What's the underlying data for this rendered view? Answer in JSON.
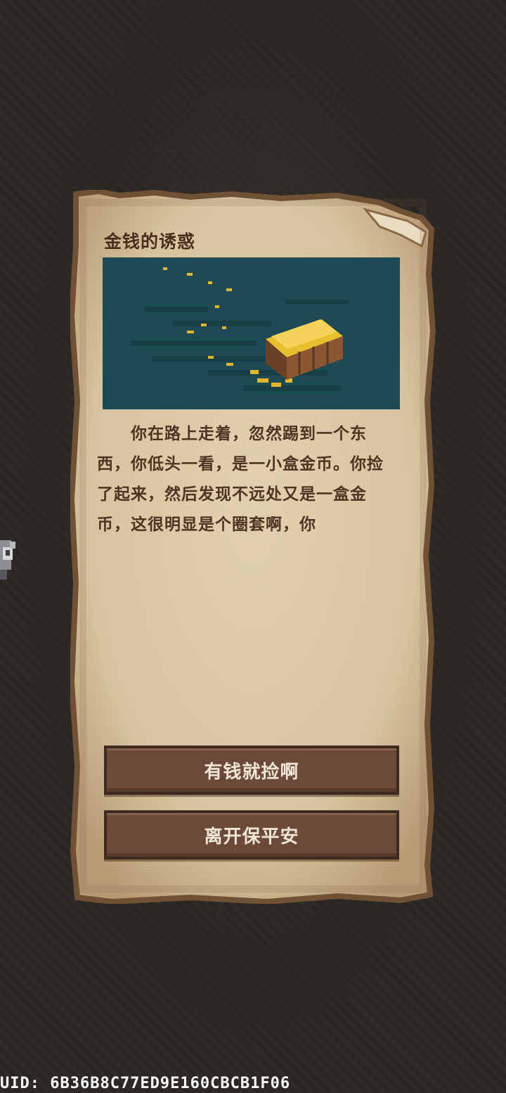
{
  "event": {
    "title": "金钱的诱惑",
    "story": "　　你在路上走着，忽然踢到一个东西，你低头一看，是一小盒金币。你捡了起来，然后发现不远处又是一盒金币，这很明显是个圈套啊，你",
    "image_icon": "treasure-box-in-water"
  },
  "choices": [
    {
      "label": "有钱就捡啊"
    },
    {
      "label": "离开保平安"
    }
  ],
  "footer": {
    "uid": "UID: 6B36B8C77ED9E160CBCB1F06"
  },
  "colors": {
    "parchment": "#d9c5a3",
    "parchment_edge": "#7b5a3d",
    "button": "#6b4a3a",
    "water": "#1e4b53",
    "gold": "#e0b630"
  }
}
